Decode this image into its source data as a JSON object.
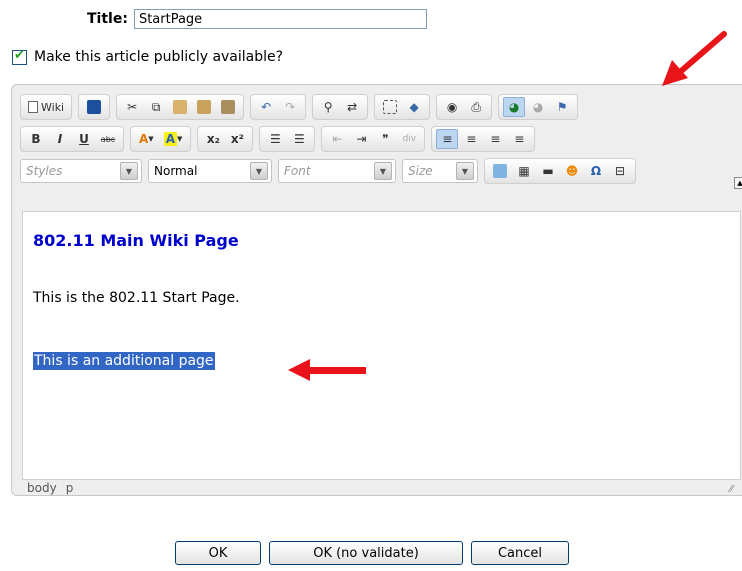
{
  "title_field": {
    "label": "Title:",
    "value": "StartPage"
  },
  "public_checkbox": {
    "label": "Make this article publicly available?",
    "checked": true
  },
  "toolbar": {
    "wiki_label": "Wiki",
    "styles_label": "Styles",
    "format_label": "Normal",
    "font_label": "Font",
    "size_label": "Size",
    "bold": "B",
    "italic": "I",
    "underline": "U",
    "strike": "abc",
    "subscript": "x₂",
    "superscript": "x²",
    "quote": "❞",
    "omega": "Ω"
  },
  "content": {
    "heading": "802.11 Main Wiki Page",
    "paragraph1": "This is the 802.11 Start Page.",
    "paragraph2_selected": "This is an additional page"
  },
  "status_path": [
    "body",
    "p"
  ],
  "buttons": {
    "ok": "OK",
    "ok_no_validate": "OK (no validate)",
    "cancel": "Cancel"
  },
  "colors": {
    "heading": "#0000cc",
    "selection": "#3166c5",
    "arrow": "#e8141a"
  }
}
